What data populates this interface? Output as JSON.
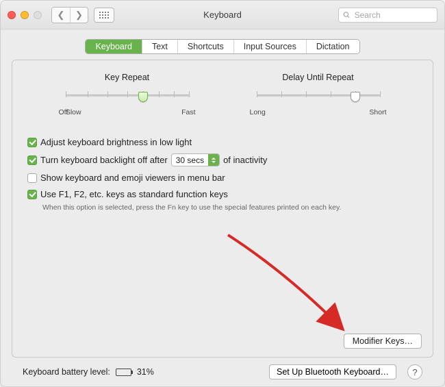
{
  "window": {
    "title": "Keyboard"
  },
  "search": {
    "placeholder": "Search"
  },
  "tabs": [
    "Keyboard",
    "Text",
    "Shortcuts",
    "Input Sources",
    "Dictation"
  ],
  "active_tab_index": 0,
  "sliders": {
    "key_repeat": {
      "label": "Key Repeat",
      "left": "Off",
      "left2": "Slow",
      "right": "Fast"
    },
    "delay": {
      "label": "Delay Until Repeat",
      "left": "Long",
      "right": "Short"
    }
  },
  "options": {
    "brightness": "Adjust keyboard brightness in low light",
    "backlight_pre": "Turn keyboard backlight off after",
    "backlight_val": "30 secs",
    "backlight_post": "of inactivity",
    "menubar": "Show keyboard and emoji viewers in menu bar",
    "fnkeys": "Use F1, F2, etc. keys as standard function keys",
    "fnkeys_hint": "When this option is selected, press the Fn key to use the special features printed on each key."
  },
  "buttons": {
    "modifier": "Modifier Keys…",
    "setup": "Set Up Bluetooth Keyboard…"
  },
  "footer": {
    "battery_label": "Keyboard battery level:",
    "battery_pct": "31%"
  }
}
